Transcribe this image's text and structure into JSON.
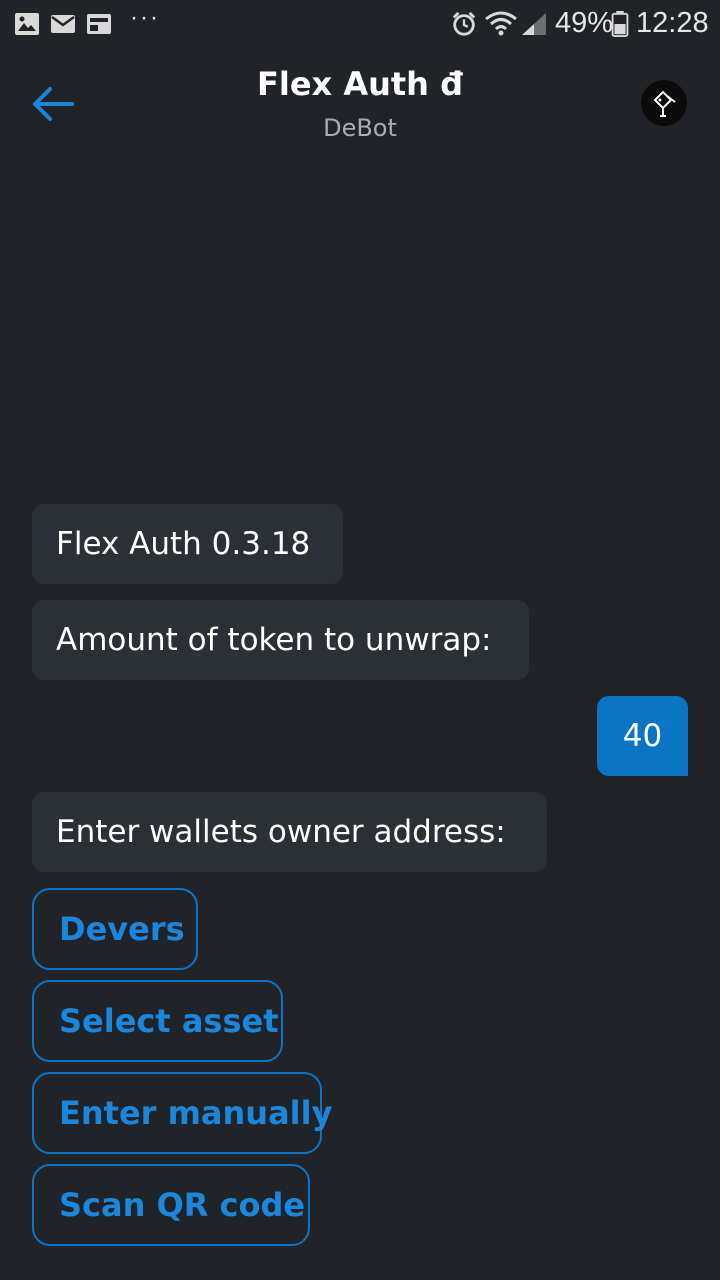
{
  "status_bar": {
    "battery": "49%",
    "time": "12:28",
    "more_indicator": "···",
    "icons": [
      "gallery-icon",
      "mail-icon",
      "news-icon",
      "alarm-icon",
      "wifi-icon",
      "signal-icon",
      "battery-icon"
    ]
  },
  "header": {
    "title": "Flex Auth đ",
    "subtitle": "DeBot",
    "back_icon": "arrow-left-icon",
    "avatar_icon": "debot-avatar-icon"
  },
  "messages": [
    {
      "from": "bot",
      "text": "Flex Auth 0.3.18"
    },
    {
      "from": "bot",
      "text": "Amount of token to unwrap:"
    },
    {
      "from": "user",
      "text": "40"
    },
    {
      "from": "bot",
      "text": "Enter wallets owner address:"
    }
  ],
  "choices": [
    {
      "label": "Devers"
    },
    {
      "label": "Select asset"
    },
    {
      "label": "Enter manually"
    },
    {
      "label": "Scan QR code"
    }
  ],
  "colors": {
    "background": "#202429",
    "bot_bubble": "#2b3036",
    "accent": "#0a74c6",
    "choice_text": "#1a86dc"
  }
}
